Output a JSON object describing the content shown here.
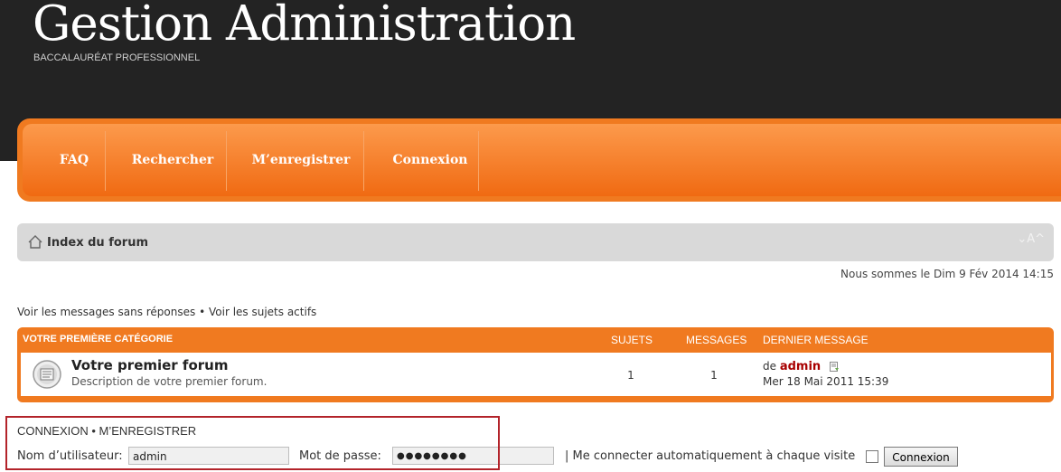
{
  "site": {
    "title": "Gestion Administration",
    "subtitle": "BACCALAURÉAT PROFESSIONNEL"
  },
  "nav": {
    "items": [
      "FAQ",
      "Rechercher",
      "M’enregistrer",
      "Connexion"
    ]
  },
  "breadcrumb": {
    "label": "Index du forum",
    "font_size_control": "⌄A^"
  },
  "date_text": "Nous sommes le Dim 9 Fév 2014 14:15",
  "quick_links": {
    "unanswered": "Voir les messages sans réponses",
    "separator": "•",
    "active": "Voir les sujets actifs"
  },
  "category": {
    "title": "VOTRE PREMIÈRE CATÉGORIE",
    "col_topics": "SUJETS",
    "col_posts": "MESSAGES",
    "col_last": "DERNIER MESSAGE",
    "forums": [
      {
        "title": "Votre premier forum",
        "description": "Description de votre premier forum.",
        "topics": "1",
        "posts": "1",
        "last_prefix": "de",
        "last_author": "admin",
        "last_date": "Mer 18 Mai 2011 15:39"
      }
    ]
  },
  "login": {
    "title_login": "CONNEXION",
    "title_sep": "•",
    "title_register": "M’ENREGISTRER",
    "username_label": "Nom d’utilisateur:",
    "username_value": "admin",
    "password_label": "Mot de passe:",
    "password_value": "●●●●●●●●",
    "autologin_label": "| Me connecter automatiquement à chaque visite",
    "submit_label": "Connexion"
  },
  "colors": {
    "header_bg": "#232323",
    "accent": "#f07a20",
    "author": "#a80000",
    "highlight_border": "#b3232a"
  }
}
